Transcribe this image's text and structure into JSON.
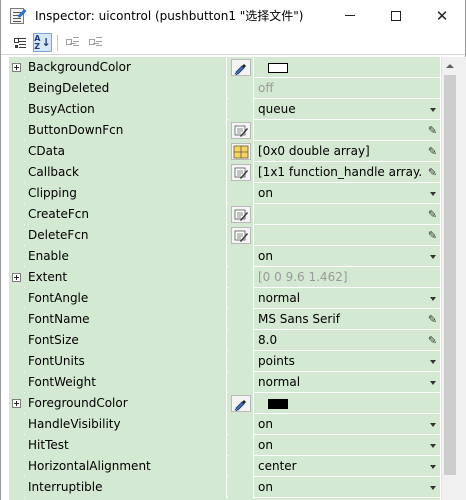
{
  "window": {
    "title": "Inspector:  uicontrol (pushbutton1 \"选择文件\")",
    "controls": {
      "close": "✕"
    }
  },
  "toolbar": {
    "buttons": [
      {
        "icon": "categorized-view-icon",
        "active": false
      },
      {
        "icon": "alphabetical-sort-icon",
        "active": true,
        "label_top": "A",
        "label_bottom": "Z"
      },
      {
        "icon": "expand-all-icon",
        "active": false
      },
      {
        "icon": "collapse-all-icon",
        "active": false
      }
    ]
  },
  "properties": [
    {
      "name": "BackgroundColor",
      "expandable": true,
      "edit_icon": "color-picker-icon",
      "value": "",
      "swatch": "#ffffff",
      "action": "none"
    },
    {
      "name": "BeingDeleted",
      "expandable": false,
      "edit_icon": "",
      "value": "off",
      "gray": true,
      "action": "none"
    },
    {
      "name": "BusyAction",
      "expandable": false,
      "edit_icon": "",
      "value": "queue",
      "action": "dropdown"
    },
    {
      "name": "ButtonDownFcn",
      "expandable": false,
      "edit_icon": "callback-editor-icon",
      "value": "",
      "action": "edit"
    },
    {
      "name": "CData",
      "expandable": false,
      "edit_icon": "array-editor-icon",
      "value": "[0x0  double array]",
      "action": "edit"
    },
    {
      "name": "Callback",
      "expandable": false,
      "edit_icon": "callback-editor-icon",
      "value": "[1x1  function_handle array...",
      "action": "edit"
    },
    {
      "name": "Clipping",
      "expandable": false,
      "edit_icon": "",
      "value": "on",
      "action": "dropdown"
    },
    {
      "name": "CreateFcn",
      "expandable": false,
      "edit_icon": "callback-editor-icon",
      "value": "",
      "action": "edit"
    },
    {
      "name": "DeleteFcn",
      "expandable": false,
      "edit_icon": "callback-editor-icon",
      "value": "",
      "action": "edit"
    },
    {
      "name": "Enable",
      "expandable": false,
      "edit_icon": "",
      "value": "on",
      "action": "dropdown"
    },
    {
      "name": "Extent",
      "expandable": true,
      "edit_icon": "",
      "value": "[0 0 9.6 1.462]",
      "gray": true,
      "action": "none"
    },
    {
      "name": "FontAngle",
      "expandable": false,
      "edit_icon": "",
      "value": "normal",
      "action": "dropdown"
    },
    {
      "name": "FontName",
      "expandable": false,
      "edit_icon": "",
      "value": "MS Sans Serif",
      "action": "edit"
    },
    {
      "name": "FontSize",
      "expandable": false,
      "edit_icon": "",
      "value": "8.0",
      "action": "edit"
    },
    {
      "name": "FontUnits",
      "expandable": false,
      "edit_icon": "",
      "value": "points",
      "action": "dropdown"
    },
    {
      "name": "FontWeight",
      "expandable": false,
      "edit_icon": "",
      "value": "normal",
      "action": "dropdown"
    },
    {
      "name": "ForegroundColor",
      "expandable": true,
      "edit_icon": "color-picker-icon",
      "value": "",
      "swatch": "#000000",
      "action": "none"
    },
    {
      "name": "HandleVisibility",
      "expandable": false,
      "edit_icon": "",
      "value": "on",
      "action": "dropdown"
    },
    {
      "name": "HitTest",
      "expandable": false,
      "edit_icon": "",
      "value": "on",
      "action": "dropdown"
    },
    {
      "name": "HorizontalAlignment",
      "expandable": false,
      "edit_icon": "",
      "value": "center",
      "action": "dropdown"
    },
    {
      "name": "Interruptible",
      "expandable": false,
      "edit_icon": "",
      "value": "on",
      "action": "dropdown"
    }
  ],
  "colors": {
    "grid_background": "#d4e9d1",
    "row_separator": "#ffffff",
    "disabled_text": "#9a9a9a"
  }
}
